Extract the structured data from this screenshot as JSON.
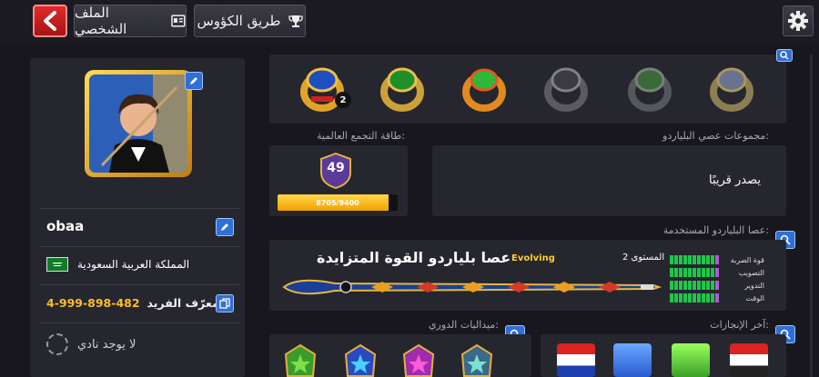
{
  "topbar": {
    "back_icon": "chevron-left-icon",
    "profile_tab_label": "الملف الشخصي",
    "trophy_tab_label": "طريق الكؤوس",
    "settings_icon": "gear-icon"
  },
  "profile": {
    "username": "obaa",
    "country": "المملكة العربية السعودية",
    "uid_label": "المعرّف الفريد:",
    "uid_value": "4-999-898-482",
    "club": "لا يوجد نادي"
  },
  "rings": {
    "count_badge": "2"
  },
  "sections": {
    "energy_label": "طاقة التجمع العالمية:",
    "cue_collection_label": "مجموعات عصي البلياردو:",
    "cue_in_use_label": "عصا البلياردو المستخدمة:",
    "league_label": "ميداليات الدوري:",
    "achievements_label": "آخر الإنجازات:"
  },
  "energy": {
    "level": "49",
    "progress_text": "8705/9400",
    "progress_fraction": 0.926
  },
  "cue_collection": {
    "status": "يصدر قريبًا"
  },
  "cue": {
    "name": "عصا بلياردو القوة المتزايدة",
    "tag": "Evolving",
    "level_label": "المستوى 2",
    "stats": [
      {
        "label": "قوة الضربة",
        "filled": 10,
        "extra": 1
      },
      {
        "label": "التصويب",
        "filled": 10,
        "extra": 1
      },
      {
        "label": "التدوير",
        "filled": 10,
        "extra": 1
      },
      {
        "label": "الوقت",
        "filled": 10,
        "extra": 1
      }
    ]
  },
  "colors": {
    "accent_blue": "#2f6fd6",
    "gold": "#ffbf2a",
    "back_red": "#d42020"
  }
}
